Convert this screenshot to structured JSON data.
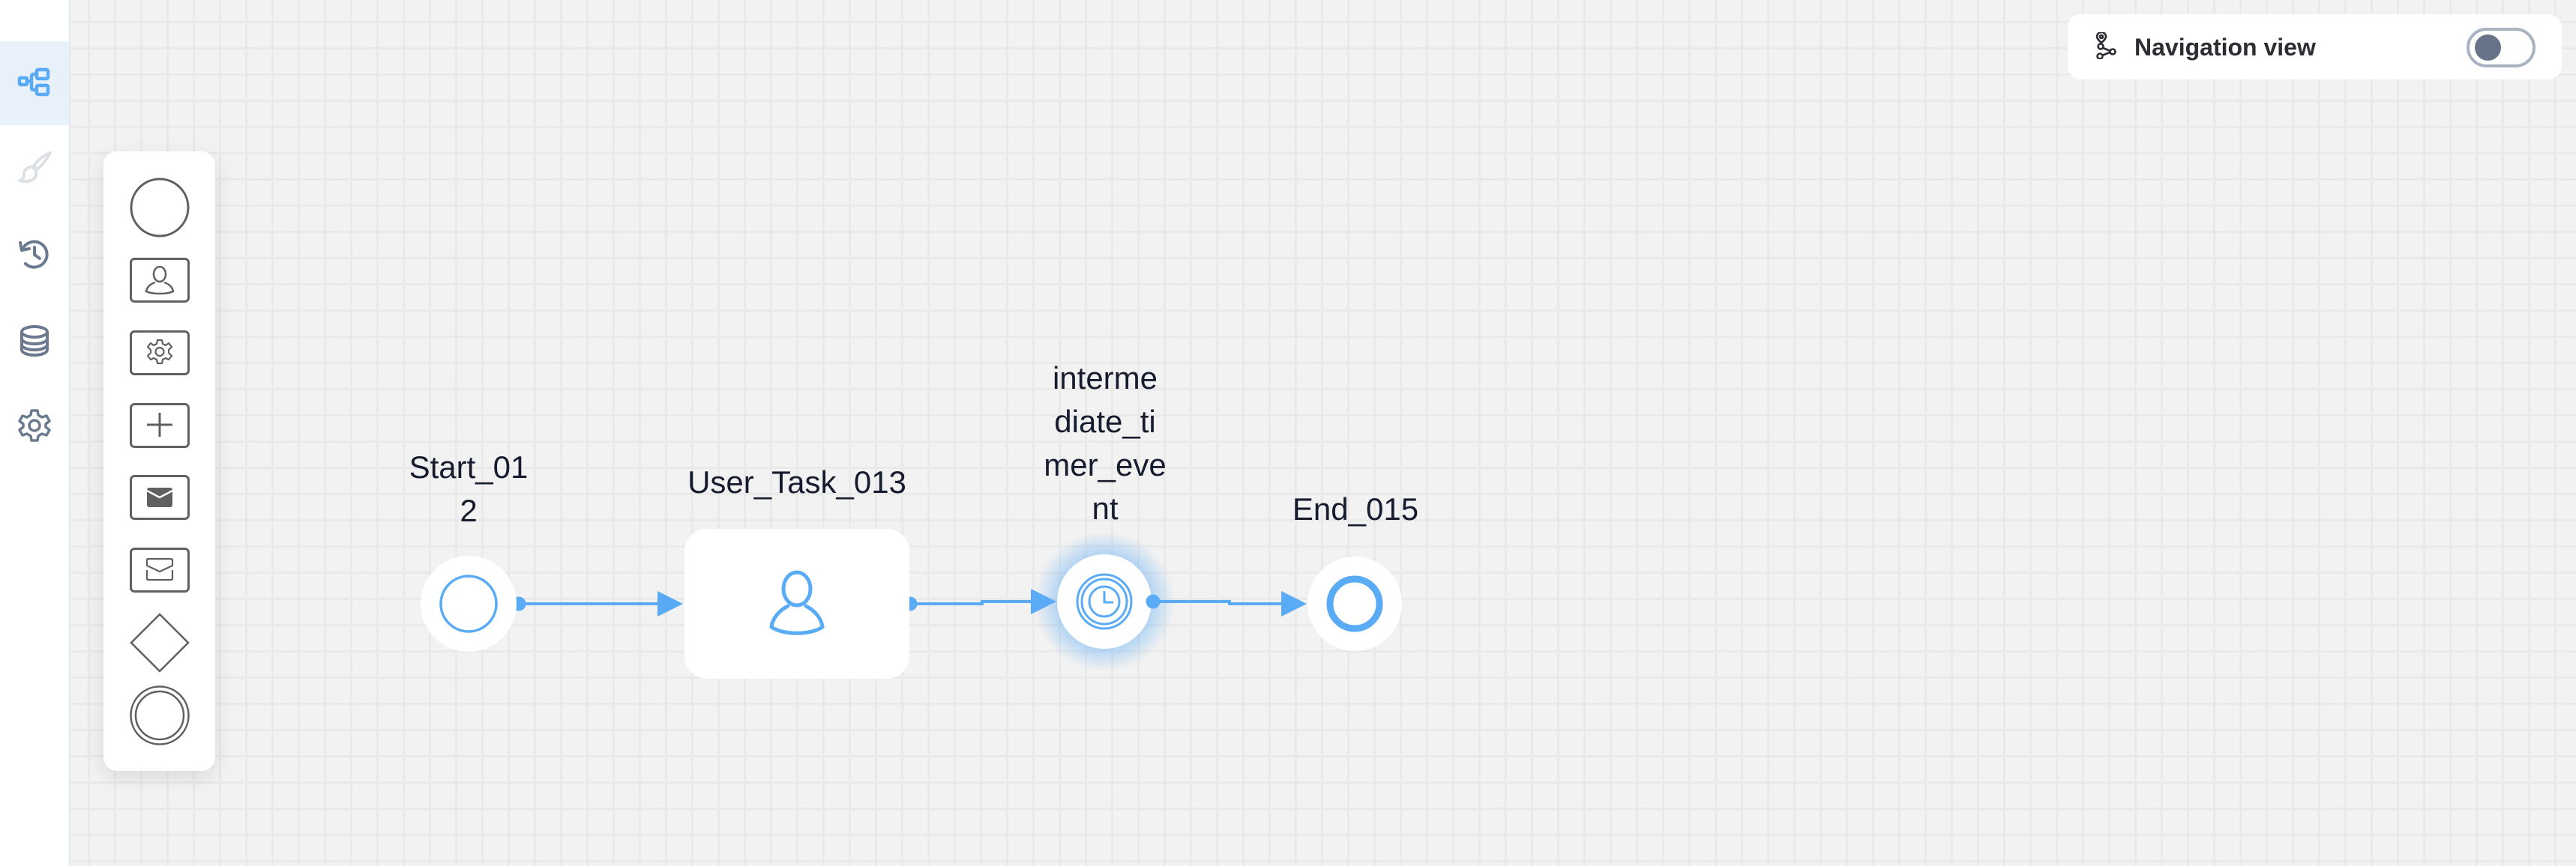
{
  "sidebar": {
    "items": [
      {
        "id": "diagram",
        "icon": "diagram-icon",
        "active": true
      },
      {
        "id": "style",
        "icon": "brush-icon",
        "disabled": true
      },
      {
        "id": "history",
        "icon": "history-icon"
      },
      {
        "id": "data",
        "icon": "database-icon"
      },
      {
        "id": "settings",
        "icon": "settings-icon"
      }
    ],
    "colors": {
      "active": "#5aabf5",
      "normal": "#6b7a8f",
      "disabled": "#dde1e6"
    }
  },
  "palette": {
    "items": [
      {
        "id": "start-event",
        "icon": "start-event-icon"
      },
      {
        "id": "user-task",
        "icon": "user-task-icon"
      },
      {
        "id": "service-task",
        "icon": "service-task-icon"
      },
      {
        "id": "subprocess",
        "icon": "subprocess-icon"
      },
      {
        "id": "send-task",
        "icon": "send-task-icon"
      },
      {
        "id": "receive-task",
        "icon": "receive-task-icon"
      },
      {
        "id": "gateway",
        "icon": "gateway-icon"
      },
      {
        "id": "intermediate-event",
        "icon": "intermediate-event-icon"
      }
    ]
  },
  "diagram": {
    "accent": "#5aabf5",
    "nodes": [
      {
        "id": "Start_012",
        "type": "start-event",
        "label": "Start_01\n2"
      },
      {
        "id": "User_Task_013",
        "type": "user-task",
        "label": "User_Task_013"
      },
      {
        "id": "intermediate_timer_event",
        "type": "timer-event",
        "label": "interme\ndiate_ti\nmer_eve\nnt",
        "selected": true
      },
      {
        "id": "End_015",
        "type": "end-event",
        "label": "End_015"
      }
    ],
    "edges": [
      {
        "from": "Start_012",
        "to": "User_Task_013"
      },
      {
        "from": "User_Task_013",
        "to": "intermediate_timer_event"
      },
      {
        "from": "intermediate_timer_event",
        "to": "End_015"
      }
    ]
  },
  "nav": {
    "label": "Navigation view",
    "enabled": false
  }
}
